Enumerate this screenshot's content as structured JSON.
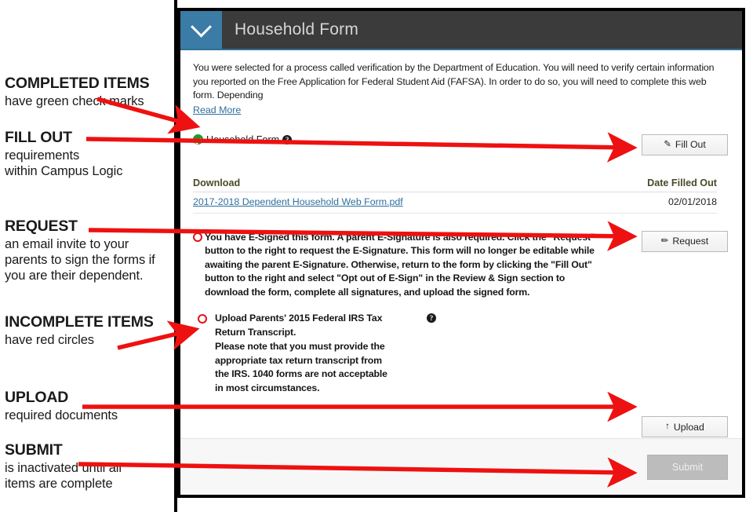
{
  "annotations": [
    {
      "id": "completed",
      "title": "COMPLETED ITEMS",
      "body": "have green check marks"
    },
    {
      "id": "fill-out",
      "title": "FILL OUT",
      "body": "requirements\nwithin Campus Logic"
    },
    {
      "id": "request",
      "title": "REQUEST",
      "body": "an email invite to your\nparents to sign the forms if\nyou are their dependent."
    },
    {
      "id": "incomplete",
      "title": "INCOMPLETE ITEMS",
      "body": "have red circles"
    },
    {
      "id": "upload",
      "title": "UPLOAD",
      "body": "required documents"
    },
    {
      "id": "submit",
      "title": "SUBMIT",
      "body": "is inactivated until all\nitems are complete"
    }
  ],
  "panel": {
    "header": {
      "title": "Household Form",
      "toggle_icon": "chevron-down-icon",
      "accent_color": "#3a7ca5",
      "bar_color": "#3b3b3b"
    },
    "intro": {
      "text": "You were selected for a process called verification by the Department of Education. You will need to verify certain information you reported on the Free Application for Federal Student Aid (FAFSA). In order to do so, you will need to complete this web form. Depending",
      "read_more_label": "Read More"
    },
    "completed_item": {
      "status_icon": "green-check-icon",
      "status_color": "#219a29",
      "label": "Household Form",
      "help_icon": "question-mark-icon",
      "action_button": {
        "label": "Fill Out",
        "icon": "pencil-square-icon",
        "icon_glyph": "✎"
      }
    },
    "download_table": {
      "columns": [
        "Download",
        "Date Filled Out"
      ],
      "rows": [
        {
          "file_name": "2017-2018 Dependent Household Web Form.pdf",
          "date_filled_out": "02/01/2018"
        }
      ]
    },
    "esign_item": {
      "status_icon": "red-circle-icon",
      "status_color": "#e2101b",
      "text": "You have E-Signed this form. A parent E-Signature is also required. Click the \"Request\" button to the right to request the E-Signature. This form will no longer be editable while awaiting the parent E-Signature. Otherwise, return to the form by clicking the \"Fill Out\" button to the right and select \"Opt out of E-Sign\" in the Review & Sign section to download the form, complete all signatures, and upload the signed form.",
      "action_button": {
        "label": "Request",
        "icon": "pencil-icon",
        "icon_glyph": "✏"
      }
    },
    "upload_item": {
      "status_icon": "red-circle-icon",
      "status_color": "#e2101b",
      "text": "Upload Parents' 2015 Federal IRS Tax Return Transcript.\nPlease note that you must provide the appropriate tax return transcript from the IRS. 1040 forms are not acceptable in most circumstances.",
      "help_icon": "question-mark-icon",
      "action_button": {
        "label": "Upload",
        "icon": "arrow-up-icon",
        "icon_glyph": "↑"
      }
    },
    "footer": {
      "submit_label": "Submit",
      "submit_enabled": false,
      "submit_bg": "#bcbcbc"
    }
  },
  "arrow_color": "#ee1111"
}
